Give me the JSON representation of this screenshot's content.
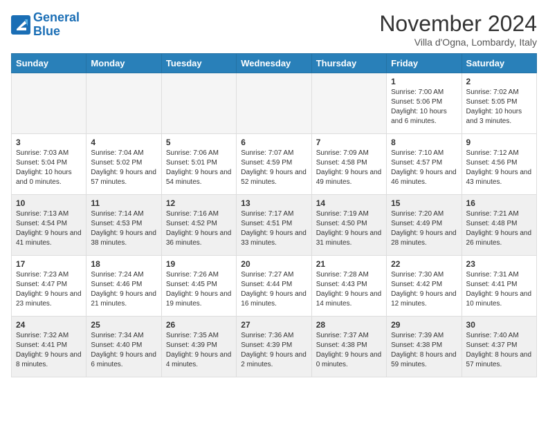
{
  "header": {
    "logo_line1": "General",
    "logo_line2": "Blue",
    "month": "November 2024",
    "location": "Villa d'Ogna, Lombardy, Italy"
  },
  "weekdays": [
    "Sunday",
    "Monday",
    "Tuesday",
    "Wednesday",
    "Thursday",
    "Friday",
    "Saturday"
  ],
  "weeks": [
    [
      {
        "day": "",
        "empty": true
      },
      {
        "day": "",
        "empty": true
      },
      {
        "day": "",
        "empty": true
      },
      {
        "day": "",
        "empty": true
      },
      {
        "day": "",
        "empty": true
      },
      {
        "day": "1",
        "sunrise": "Sunrise: 7:00 AM",
        "sunset": "Sunset: 5:06 PM",
        "daylight": "Daylight: 10 hours and 6 minutes."
      },
      {
        "day": "2",
        "sunrise": "Sunrise: 7:02 AM",
        "sunset": "Sunset: 5:05 PM",
        "daylight": "Daylight: 10 hours and 3 minutes."
      }
    ],
    [
      {
        "day": "3",
        "sunrise": "Sunrise: 7:03 AM",
        "sunset": "Sunset: 5:04 PM",
        "daylight": "Daylight: 10 hours and 0 minutes."
      },
      {
        "day": "4",
        "sunrise": "Sunrise: 7:04 AM",
        "sunset": "Sunset: 5:02 PM",
        "daylight": "Daylight: 9 hours and 57 minutes."
      },
      {
        "day": "5",
        "sunrise": "Sunrise: 7:06 AM",
        "sunset": "Sunset: 5:01 PM",
        "daylight": "Daylight: 9 hours and 54 minutes."
      },
      {
        "day": "6",
        "sunrise": "Sunrise: 7:07 AM",
        "sunset": "Sunset: 4:59 PM",
        "daylight": "Daylight: 9 hours and 52 minutes."
      },
      {
        "day": "7",
        "sunrise": "Sunrise: 7:09 AM",
        "sunset": "Sunset: 4:58 PM",
        "daylight": "Daylight: 9 hours and 49 minutes."
      },
      {
        "day": "8",
        "sunrise": "Sunrise: 7:10 AM",
        "sunset": "Sunset: 4:57 PM",
        "daylight": "Daylight: 9 hours and 46 minutes."
      },
      {
        "day": "9",
        "sunrise": "Sunrise: 7:12 AM",
        "sunset": "Sunset: 4:56 PM",
        "daylight": "Daylight: 9 hours and 43 minutes."
      }
    ],
    [
      {
        "day": "10",
        "sunrise": "Sunrise: 7:13 AM",
        "sunset": "Sunset: 4:54 PM",
        "daylight": "Daylight: 9 hours and 41 minutes."
      },
      {
        "day": "11",
        "sunrise": "Sunrise: 7:14 AM",
        "sunset": "Sunset: 4:53 PM",
        "daylight": "Daylight: 9 hours and 38 minutes."
      },
      {
        "day": "12",
        "sunrise": "Sunrise: 7:16 AM",
        "sunset": "Sunset: 4:52 PM",
        "daylight": "Daylight: 9 hours and 36 minutes."
      },
      {
        "day": "13",
        "sunrise": "Sunrise: 7:17 AM",
        "sunset": "Sunset: 4:51 PM",
        "daylight": "Daylight: 9 hours and 33 minutes."
      },
      {
        "day": "14",
        "sunrise": "Sunrise: 7:19 AM",
        "sunset": "Sunset: 4:50 PM",
        "daylight": "Daylight: 9 hours and 31 minutes."
      },
      {
        "day": "15",
        "sunrise": "Sunrise: 7:20 AM",
        "sunset": "Sunset: 4:49 PM",
        "daylight": "Daylight: 9 hours and 28 minutes."
      },
      {
        "day": "16",
        "sunrise": "Sunrise: 7:21 AM",
        "sunset": "Sunset: 4:48 PM",
        "daylight": "Daylight: 9 hours and 26 minutes."
      }
    ],
    [
      {
        "day": "17",
        "sunrise": "Sunrise: 7:23 AM",
        "sunset": "Sunset: 4:47 PM",
        "daylight": "Daylight: 9 hours and 23 minutes."
      },
      {
        "day": "18",
        "sunrise": "Sunrise: 7:24 AM",
        "sunset": "Sunset: 4:46 PM",
        "daylight": "Daylight: 9 hours and 21 minutes."
      },
      {
        "day": "19",
        "sunrise": "Sunrise: 7:26 AM",
        "sunset": "Sunset: 4:45 PM",
        "daylight": "Daylight: 9 hours and 19 minutes."
      },
      {
        "day": "20",
        "sunrise": "Sunrise: 7:27 AM",
        "sunset": "Sunset: 4:44 PM",
        "daylight": "Daylight: 9 hours and 16 minutes."
      },
      {
        "day": "21",
        "sunrise": "Sunrise: 7:28 AM",
        "sunset": "Sunset: 4:43 PM",
        "daylight": "Daylight: 9 hours and 14 minutes."
      },
      {
        "day": "22",
        "sunrise": "Sunrise: 7:30 AM",
        "sunset": "Sunset: 4:42 PM",
        "daylight": "Daylight: 9 hours and 12 minutes."
      },
      {
        "day": "23",
        "sunrise": "Sunrise: 7:31 AM",
        "sunset": "Sunset: 4:41 PM",
        "daylight": "Daylight: 9 hours and 10 minutes."
      }
    ],
    [
      {
        "day": "24",
        "sunrise": "Sunrise: 7:32 AM",
        "sunset": "Sunset: 4:41 PM",
        "daylight": "Daylight: 9 hours and 8 minutes."
      },
      {
        "day": "25",
        "sunrise": "Sunrise: 7:34 AM",
        "sunset": "Sunset: 4:40 PM",
        "daylight": "Daylight: 9 hours and 6 minutes."
      },
      {
        "day": "26",
        "sunrise": "Sunrise: 7:35 AM",
        "sunset": "Sunset: 4:39 PM",
        "daylight": "Daylight: 9 hours and 4 minutes."
      },
      {
        "day": "27",
        "sunrise": "Sunrise: 7:36 AM",
        "sunset": "Sunset: 4:39 PM",
        "daylight": "Daylight: 9 hours and 2 minutes."
      },
      {
        "day": "28",
        "sunrise": "Sunrise: 7:37 AM",
        "sunset": "Sunset: 4:38 PM",
        "daylight": "Daylight: 9 hours and 0 minutes."
      },
      {
        "day": "29",
        "sunrise": "Sunrise: 7:39 AM",
        "sunset": "Sunset: 4:38 PM",
        "daylight": "Daylight: 8 hours and 59 minutes."
      },
      {
        "day": "30",
        "sunrise": "Sunrise: 7:40 AM",
        "sunset": "Sunset: 4:37 PM",
        "daylight": "Daylight: 8 hours and 57 minutes."
      }
    ]
  ]
}
